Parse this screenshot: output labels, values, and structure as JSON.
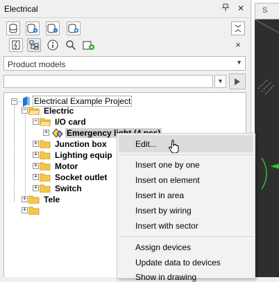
{
  "panel": {
    "title": "Electrical",
    "pin_icon": "pin-icon",
    "close_icon": "close-icon",
    "toolbar2_close": "×"
  },
  "product_models": {
    "value": "Product models"
  },
  "filter": {
    "value": "",
    "placeholder": ""
  },
  "tree": {
    "root": "Electrical Example Project",
    "nodes": [
      {
        "label": "Electric"
      },
      {
        "label": "I/O card"
      },
      {
        "label": "Emergency light (4 pcs)"
      },
      {
        "label": "Junction box"
      },
      {
        "label": "Lighting equip"
      },
      {
        "label": "Motor"
      },
      {
        "label": "Socket outlet"
      },
      {
        "label": "Switch"
      },
      {
        "label": "Tele"
      }
    ]
  },
  "context_menu": {
    "items": [
      {
        "label": "Edit..."
      },
      {
        "label": "Insert one by one"
      },
      {
        "label": "Insert on element"
      },
      {
        "label": "Insert in area"
      },
      {
        "label": "Insert by wiring"
      },
      {
        "label": "Insert with sector"
      },
      {
        "label": "Assign devices"
      },
      {
        "label": "Update data to devices"
      },
      {
        "label": "Show in drawing"
      }
    ]
  },
  "drawing": {
    "tab_label": "S"
  },
  "colors": {
    "folder": "#f3c64c",
    "accent_green": "#22cc22",
    "selected_bg": "#dde8f3"
  }
}
